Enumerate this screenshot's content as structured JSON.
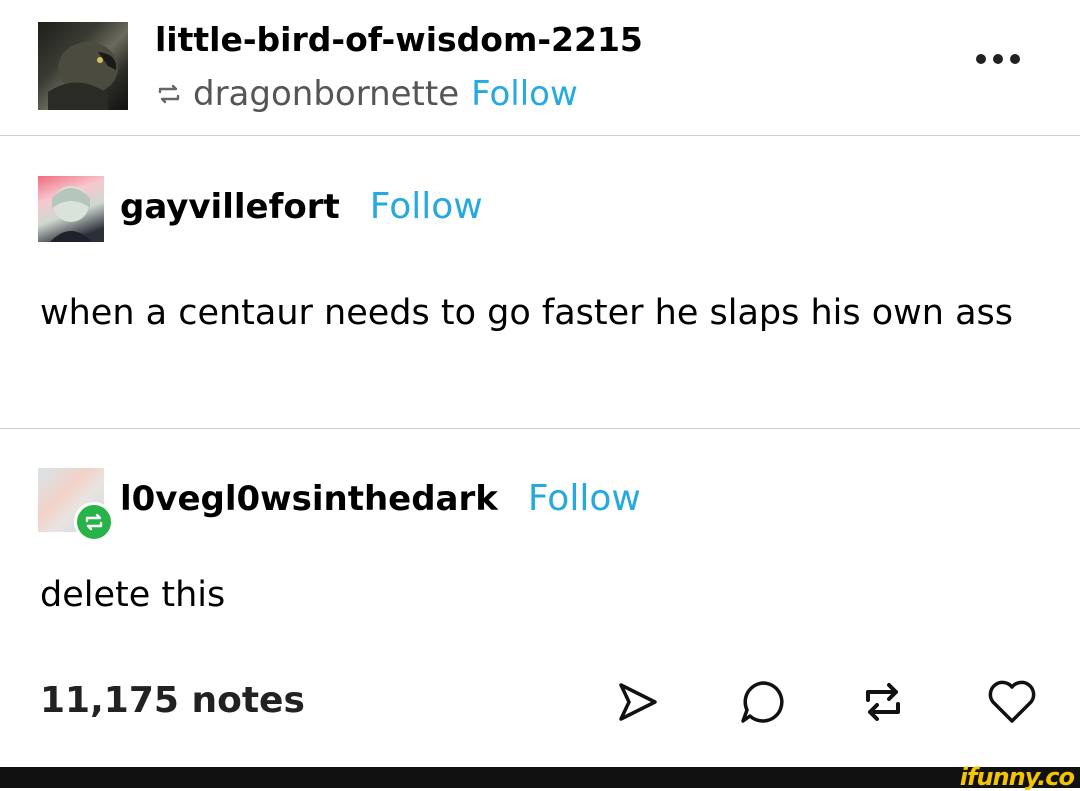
{
  "header": {
    "username": "little-bird-of-wisdom-2215",
    "reblogged_from": "dragonbornette",
    "follow_label": "Follow"
  },
  "posts": [
    {
      "username": "gayvillefort",
      "follow_label": "Follow",
      "text": "when a centaur needs to go faster he slaps his own ass"
    },
    {
      "username": "l0vegl0wsinthedark",
      "follow_label": "Follow",
      "text": "delete this"
    }
  ],
  "footer": {
    "notes": "11,175 notes",
    "watermark": "ifunny.co"
  },
  "icons": {
    "reblog": "reblog-icon",
    "more": "more-icon",
    "share": "share-icon",
    "reply": "reply-icon",
    "like": "heart-icon"
  },
  "colors": {
    "follow": "#26a9e0",
    "reblog_badge": "#27b24a",
    "watermark": "#f5c400"
  }
}
